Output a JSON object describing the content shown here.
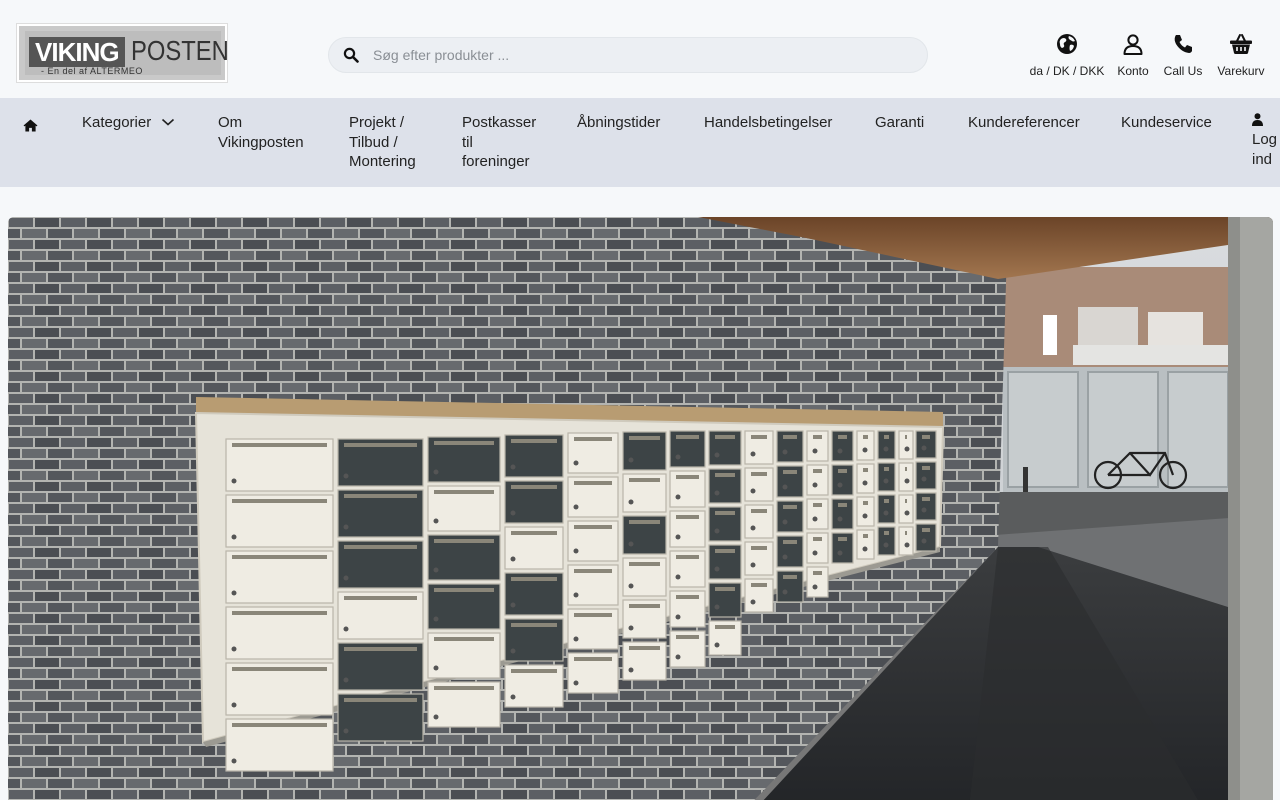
{
  "header": {
    "logo": {
      "brand_left": "VIKING",
      "brand_right": "POSTEN",
      "tagline": "- En del af ALTERMEO"
    },
    "search": {
      "placeholder": "Søg efter produkter ...",
      "value": "",
      "icon": "search-icon"
    },
    "icons": [
      {
        "name": "locale",
        "icon": "globe-icon",
        "label": "da / DK / DKK"
      },
      {
        "name": "account",
        "icon": "user-icon",
        "label": "Konto"
      },
      {
        "name": "call",
        "icon": "phone-icon",
        "label": "Call Us"
      },
      {
        "name": "cart",
        "icon": "basket-icon",
        "label": "Varekurv"
      }
    ]
  },
  "nav": {
    "home_icon": "home-icon",
    "items": [
      {
        "label": "Kategorier",
        "dropdown": true
      },
      {
        "label": "Om Vikingposten"
      },
      {
        "label": "Projekt / Tilbud / Montering"
      },
      {
        "label": "Postkasser til foreninger"
      },
      {
        "label": "Åbningstider"
      },
      {
        "label": "Handelsbetingelser"
      },
      {
        "label": "Garanti"
      },
      {
        "label": "Kundereferencer"
      },
      {
        "label": "Kundeservice"
      },
      {
        "label": "Log ind",
        "icon": "user-icon"
      }
    ]
  },
  "hero": {
    "image": "photo of a wall of mailboxes mounted on a brick wall under a covered passage",
    "colors": {
      "brick": "#5a5d62",
      "mortar": "#b8b9b6",
      "mailbox": "#e8e6dc",
      "mailbox_dark": "#3e4547",
      "ceiling": "#8a5f3c"
    }
  },
  "colors": {
    "page_bg": "#f6f8fa",
    "nav_bg": "#dde1ea",
    "search_bg": "#eceff3"
  }
}
